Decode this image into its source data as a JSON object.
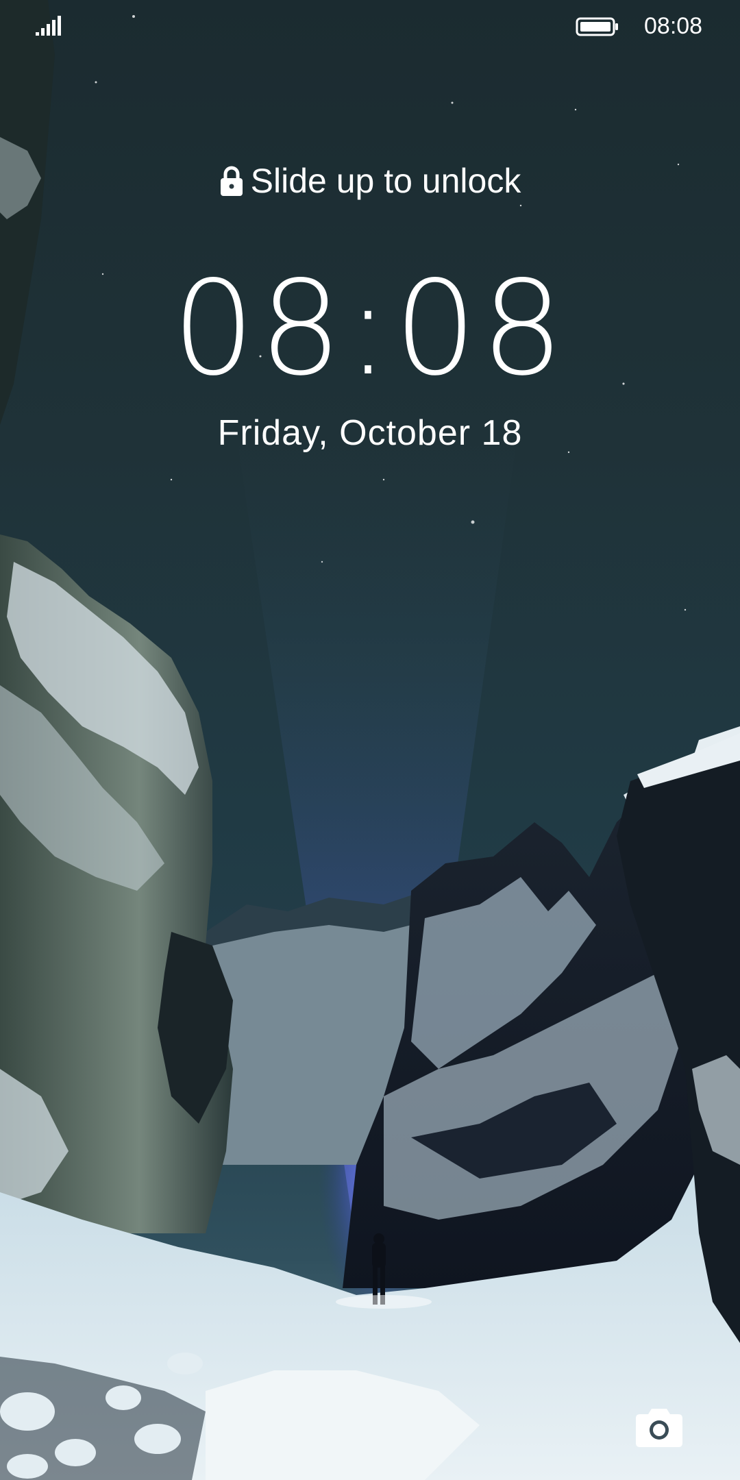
{
  "status_bar": {
    "time": "08:08",
    "signal_icon": "signal-bars-icon",
    "battery_icon": "battery-full-icon"
  },
  "lockscreen": {
    "unlock_hint": "Slide up to unlock",
    "lock_icon": "lock-icon",
    "clock": "08:08",
    "date": "Friday, October 18",
    "camera_icon": "camera-icon"
  },
  "colors": {
    "text": "#ffffff",
    "sky": "#1f3238",
    "snow": "#dfeaf0",
    "light_beam": "#5a6cff"
  }
}
